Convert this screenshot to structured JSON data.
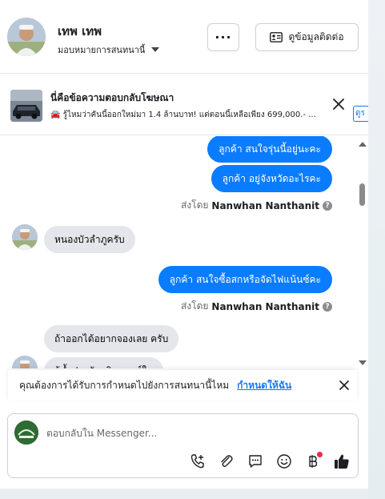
{
  "header": {
    "name": "เทพ เทพ",
    "assign_label": "มอบหมายการสนทนานี้",
    "more_label": "···",
    "contact_button": "ดูข้อมูลติดต่อ"
  },
  "ad": {
    "title": "นี่คือข้อความตอบกลับโฆษณา",
    "subtitle": "🚘 รู้ไหมว่าคันนี้ออกใหม่มา 1.4 ล้านบาท! แต่ตอนนี้เหลือเพียง 699,000.- ...",
    "cut_label": "ดูร"
  },
  "messages": {
    "out1": "ลูกค้า  สนใจรุ่นนี้อยู่นะคะ",
    "out2": "ลูกค้า   อยู่จังหวัดอะไรคะ",
    "sent_by_prefix": "ส่งโดย",
    "sent_by_name": "Nanwhan Nanthanit",
    "in1": "หนองบัวลำภูครับ",
    "out3": "ลูกค้า สนใจซื้อสกหรือจัดไฟแน้นซ์คะ",
    "in2": "ถ้าออกได้อยากจองเลย ครับ",
    "in3_partial": "ผู้ค้ำประกัน เงินดาวน์ใน"
  },
  "assign_bar": {
    "text": "คุณต้องการได้รับการกำหนดไปยังการสนทนานี้ไหม",
    "link": "กำหนดให้ฉัน"
  },
  "composer": {
    "placeholder": "ตอบกลับใน Messenger..."
  },
  "colors": {
    "outgoing_bubble": "#0a7cff",
    "incoming_bubble": "#e4e6eb",
    "link": "#1877f2"
  }
}
